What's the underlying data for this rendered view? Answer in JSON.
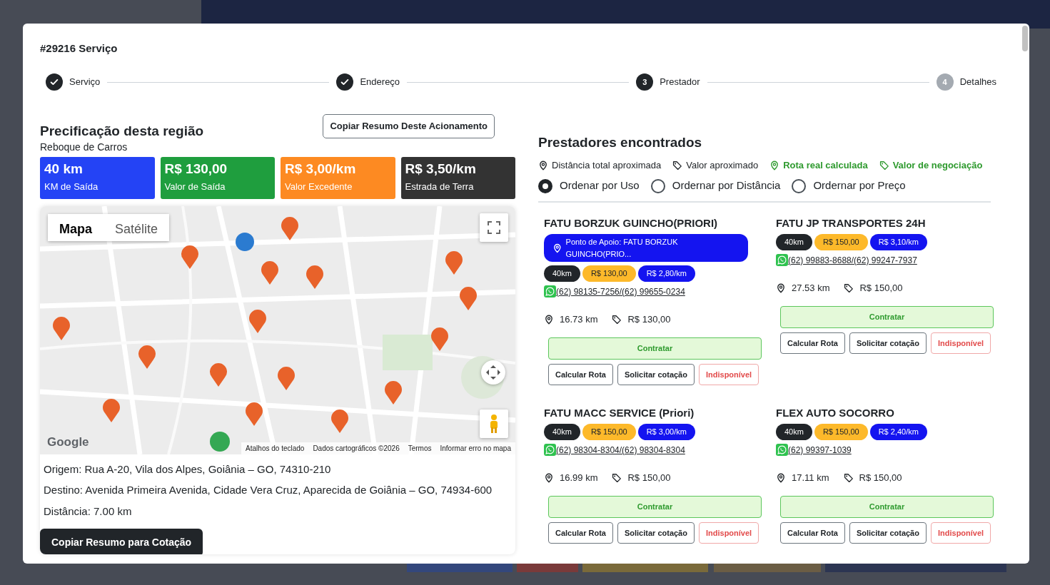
{
  "modal": {
    "title": "#29216 Serviço"
  },
  "steps": [
    {
      "label": "Serviço",
      "kind": "done"
    },
    {
      "label": "Endereço",
      "kind": "done"
    },
    {
      "label": "Prestador",
      "number": "3",
      "kind": "current"
    },
    {
      "label": "Detalhes",
      "number": "4",
      "kind": "pending"
    }
  ],
  "pricing": {
    "title": "Precificação desta região",
    "subtitle": "Reboque de Carros",
    "copy_button": "Copiar Resumo Deste Acionamento",
    "tiles": [
      {
        "value": "40 km",
        "label": "KM de Saída",
        "color": "#2443f5"
      },
      {
        "value": "R$ 130,00",
        "label": "Valor de Saída",
        "color": "#1f9e3e"
      },
      {
        "value": "R$ 3,00/km",
        "label": "Valor Excedente",
        "color": "#fd8a22"
      },
      {
        "value": "R$ 3,50/km",
        "label": "Estrada de Terra",
        "color": "#333333"
      }
    ]
  },
  "map": {
    "tabs": [
      {
        "label": "Mapa",
        "selected": true
      },
      {
        "label": "Satélite",
        "selected": false
      }
    ],
    "logo": "Google",
    "attribution": [
      "Atalhos do teclado",
      "Dados cartográficos ©2026",
      "Termos",
      "Informar erro no mapa"
    ]
  },
  "route": {
    "origin": "Origem: Rua A-20, Vila dos Alpes, Goiânia – GO, 74310-210",
    "destination": "Destino: Avenida Primeira Avenida, Cidade Vera Cruz, Aparecida de Goiânia – GO, 74934-600",
    "distance": "Distância: 7.00 km",
    "copy_button": "Copiar Resumo para Cotação"
  },
  "providers": {
    "title": "Prestadores encontrados",
    "legend": [
      {
        "label": "Distância total aproximada",
        "kind": "distance",
        "highlight": false
      },
      {
        "label": "Valor aproximado",
        "kind": "price",
        "highlight": false
      },
      {
        "label": "Rota real calculada",
        "kind": "distance",
        "highlight": true
      },
      {
        "label": "Valor de negociação",
        "kind": "price",
        "highlight": true
      }
    ],
    "sort_options": [
      {
        "label": "Ordenar por Uso",
        "selected": true
      },
      {
        "label": "Ordernar por Distância",
        "selected": false
      },
      {
        "label": "Ordernar por Preço",
        "selected": false
      }
    ],
    "cards": [
      {
        "name": "FATU BORZUK GUINCHO(PRIORI)",
        "support_point": "Ponto de Apoio: FATU BORZUK GUINCHO(PRIO...",
        "badges": [
          {
            "text": "40km",
            "kind": "km"
          },
          {
            "text": "R$ 130,00",
            "kind": "base"
          },
          {
            "text": "R$ 2,80/km",
            "kind": "per_km"
          }
        ],
        "phone": "(62) 98135-7256/(62) 99655-0234",
        "distance": "16.73 km",
        "price": "R$ 130,00",
        "buttons": [
          {
            "label": "Contratar",
            "kind": "hire"
          },
          {
            "label": "Calcular Rota",
            "kind": "neutral"
          },
          {
            "label": "Solicitar cotação",
            "kind": "neutral"
          },
          {
            "label": "Indisponível",
            "kind": "unavailable"
          }
        ]
      },
      {
        "name": "FATU JP TRANSPORTES 24H",
        "badges": [
          {
            "text": "40km",
            "kind": "km"
          },
          {
            "text": "R$ 150,00",
            "kind": "base"
          },
          {
            "text": "R$ 3,10/km",
            "kind": "per_km"
          }
        ],
        "phone": "(62) 99883-8688/(62) 99247-7937",
        "distance": "27.53 km",
        "price": "R$ 150,00",
        "buttons": [
          {
            "label": "Contratar",
            "kind": "hire"
          },
          {
            "label": "Calcular Rota",
            "kind": "neutral"
          },
          {
            "label": "Solicitar cotação",
            "kind": "neutral"
          },
          {
            "label": "Indisponível",
            "kind": "unavailable"
          }
        ]
      },
      {
        "name": "FATU MACC SERVICE (Priori)",
        "badges": [
          {
            "text": "40km",
            "kind": "km"
          },
          {
            "text": "R$ 150,00",
            "kind": "base"
          },
          {
            "text": "R$ 3,00/km",
            "kind": "per_km"
          }
        ],
        "phone": "(62) 98304-8304/(62) 98304-8304",
        "distance": "16.99 km",
        "price": "R$ 150,00",
        "buttons": [
          {
            "label": "Contratar",
            "kind": "hire"
          },
          {
            "label": "Calcular Rota",
            "kind": "neutral"
          },
          {
            "label": "Solicitar cotação",
            "kind": "neutral"
          },
          {
            "label": "Indisponível",
            "kind": "unavailable"
          }
        ]
      },
      {
        "name": "FLEX AUTO SOCORRO",
        "badges": [
          {
            "text": "40km",
            "kind": "km"
          },
          {
            "text": "R$ 150,00",
            "kind": "base"
          },
          {
            "text": "R$ 2,40/km",
            "kind": "per_km"
          }
        ],
        "phone": "(62) 99397-1039",
        "distance": "17.11 km",
        "price": "R$ 150,00",
        "buttons": [
          {
            "label": "Contratar",
            "kind": "hire"
          },
          {
            "label": "Calcular Rota",
            "kind": "neutral"
          },
          {
            "label": "Solicitar cotação",
            "kind": "neutral"
          },
          {
            "label": "Indisponível",
            "kind": "unavailable"
          }
        ]
      }
    ]
  }
}
